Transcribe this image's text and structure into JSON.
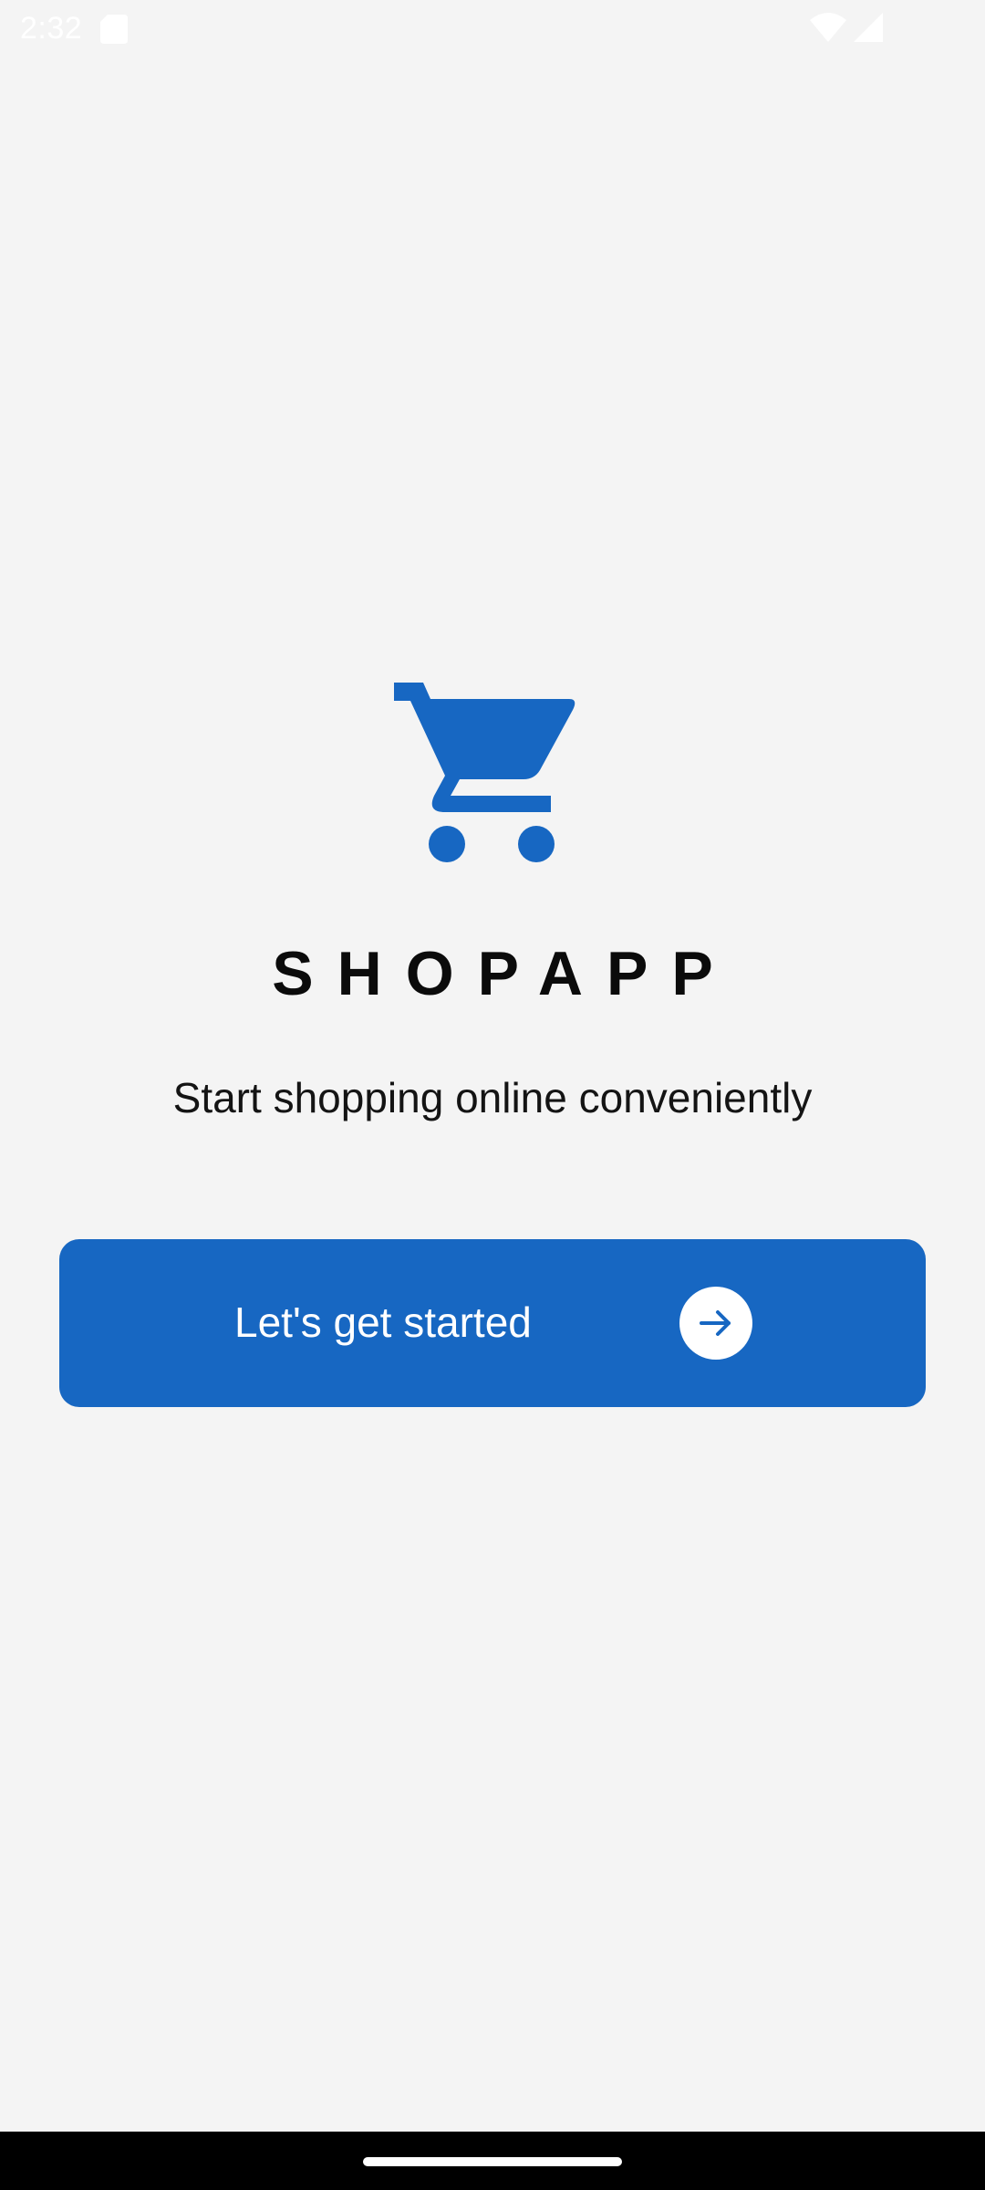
{
  "status_bar": {
    "time": "2:32",
    "icons": [
      "sd-card-icon",
      "wifi-icon",
      "signal-icon"
    ]
  },
  "hero": {
    "icon": "shopping-cart-icon",
    "title": "SHOPAPP",
    "tagline": "Start shopping online conveniently"
  },
  "cta": {
    "label": "Let's get started",
    "icon": "arrow-right-icon"
  },
  "colors": {
    "background": "#f4f4f4",
    "primary": "#1767c2",
    "text": "#0b0b0b",
    "button_text": "#ffffff"
  }
}
